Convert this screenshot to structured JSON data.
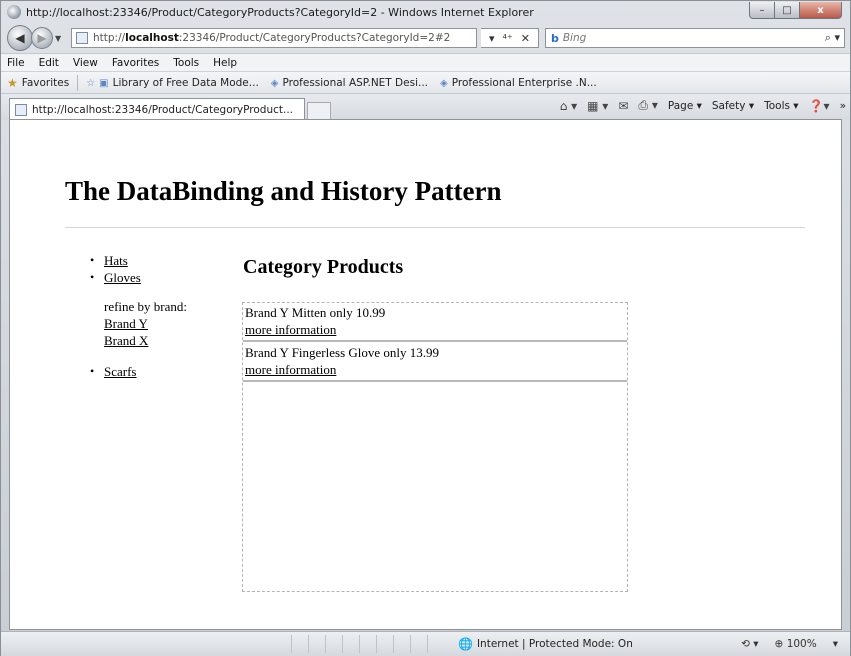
{
  "window": {
    "title": "http://localhost:23346/Product/CategoryProducts?CategoryId=2 - Windows Internet Explorer",
    "controls": {
      "minimize": "–",
      "maximize": "□",
      "close": "x"
    }
  },
  "address_bar": {
    "url_prefix": "http://",
    "url_host": "localhost",
    "url_rest": ":23346/Product/CategoryProducts?CategoryId=2#2",
    "refresh_icon": "⁴⁺",
    "stop_icon": "✕",
    "search_placeholder": "Bing",
    "search_brand": "b",
    "search_go": "⌕ ▾"
  },
  "menu": {
    "items": [
      "File",
      "Edit",
      "View",
      "Favorites",
      "Tools",
      "Help"
    ]
  },
  "favorites_bar": {
    "label": "Favorites",
    "links": [
      "Library of Free Data Mode...",
      "Professional ASP.NET Desi...",
      "Professional Enterprise .N..."
    ]
  },
  "tabs": {
    "active_tab": "http://localhost:23346/Product/CategoryProduct..."
  },
  "command_bar": {
    "page": "Page ▾",
    "safety": "Safety ▾",
    "tools": "Tools ▾",
    "help": "▾",
    "more": "»"
  },
  "page": {
    "title": "The DataBinding and History Pattern",
    "categories": {
      "hats": "Hats",
      "gloves": "Gloves",
      "refine_label": "refine by brand:",
      "brands": [
        "Brand Y",
        "Brand X"
      ],
      "scarfs": "Scarfs"
    },
    "heading": "Category Products",
    "products": [
      {
        "text": "Brand Y Mitten only 10.99",
        "link": "more information"
      },
      {
        "text": "Brand Y Fingerless Glove only 13.99",
        "link": "more information"
      }
    ]
  },
  "status_bar": {
    "zone": "Internet | Protected Mode: On",
    "zoom": "100%",
    "zoom_caret": "▾"
  },
  "colors": {
    "frame": "#dfe3e8",
    "content_bg": "#ffffff",
    "link": "#000000"
  }
}
